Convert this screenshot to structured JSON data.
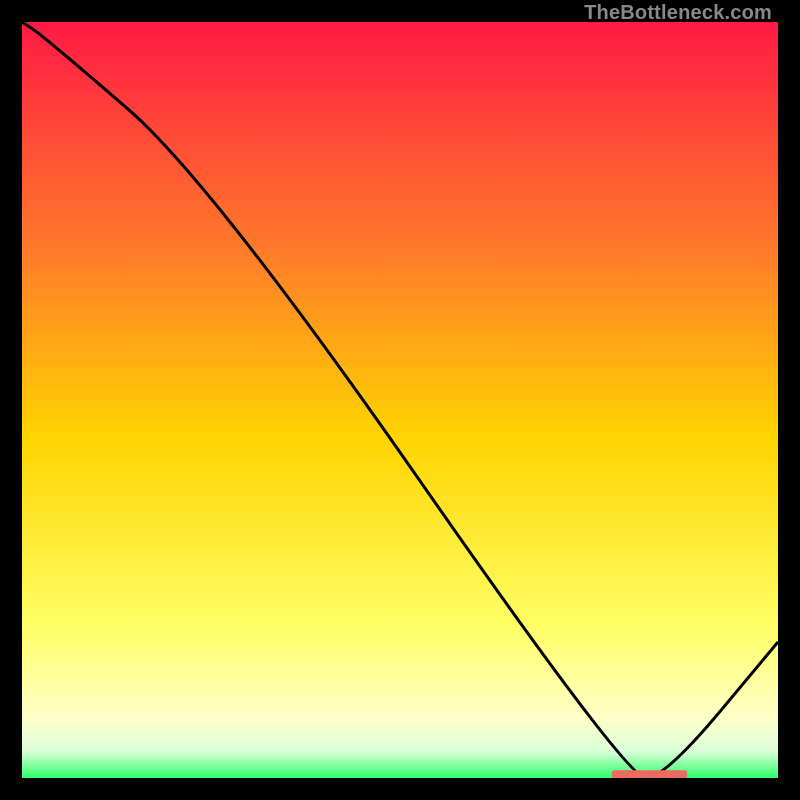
{
  "attribution": "TheBottleneck.com",
  "colors": {
    "bg": "#000000",
    "line": "#000000",
    "marker": "#ec6a5e",
    "grad_top": "#ff1a44",
    "grad_upper": "#ff7a2a",
    "grad_mid": "#ffd400",
    "grad_lower": "#ffff66",
    "grad_pale": "#ffffc8",
    "grad_green_pale": "#d9ffd9",
    "grad_green": "#2eff6a"
  },
  "chart_data": {
    "type": "line",
    "title": "",
    "xlabel": "",
    "ylabel": "",
    "xlim": [
      0,
      100
    ],
    "ylim": [
      0,
      100
    ],
    "x": [
      0,
      3,
      25,
      80,
      85,
      100
    ],
    "values": [
      100,
      98,
      79,
      0,
      0,
      18
    ],
    "marker": {
      "x_start": 78,
      "x_end": 88,
      "y": 0.5
    },
    "gradient_stops": [
      {
        "offset": 0.0,
        "key": "grad_top"
      },
      {
        "offset": 0.3,
        "key": "grad_upper"
      },
      {
        "offset": 0.55,
        "key": "grad_mid"
      },
      {
        "offset": 0.8,
        "key": "grad_lower"
      },
      {
        "offset": 0.92,
        "key": "grad_pale"
      },
      {
        "offset": 0.965,
        "key": "grad_green_pale"
      },
      {
        "offset": 1.0,
        "key": "grad_green"
      }
    ]
  }
}
